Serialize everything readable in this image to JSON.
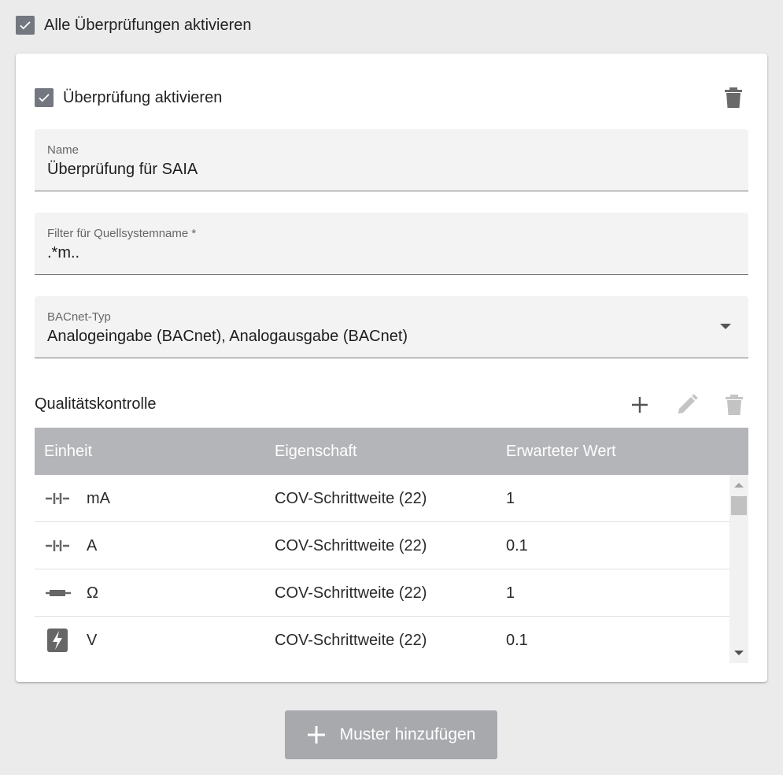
{
  "global": {
    "enable_all_label": "Alle Überprüfungen aktivieren",
    "enable_all_checked": true
  },
  "check": {
    "enable_label": "Überprüfung aktivieren",
    "enable_checked": true,
    "name_label": "Name",
    "name_value": "Überprüfung für SAIA",
    "filter_label": "Filter für Quellsystemname *",
    "filter_value": ".*m..",
    "bacnet_label": "BACnet-Typ",
    "bacnet_value": "Analogeingabe (BACnet), Analogausgabe (BACnet)"
  },
  "quality": {
    "title": "Qualitätskontrolle",
    "columns": [
      "Einheit",
      "Eigenschaft",
      "Erwarteter Wert"
    ],
    "rows": [
      {
        "icon": "current-icon",
        "unit": "mA",
        "property": "COV-Schrittweite (22)",
        "expected": "1"
      },
      {
        "icon": "current-icon",
        "unit": "A",
        "property": "COV-Schrittweite (22)",
        "expected": "0.1"
      },
      {
        "icon": "resistor-icon",
        "unit": "Ω",
        "property": "COV-Schrittweite (22)",
        "expected": "1"
      },
      {
        "icon": "voltage-icon",
        "unit": "V",
        "property": "COV-Schrittweite (22)",
        "expected": "0.1"
      }
    ]
  },
  "add_button_label": "Muster hinzufügen",
  "colors": {
    "checkbox": "#73777f",
    "header": "#b4b5b9",
    "button": "#a7a9ad"
  }
}
